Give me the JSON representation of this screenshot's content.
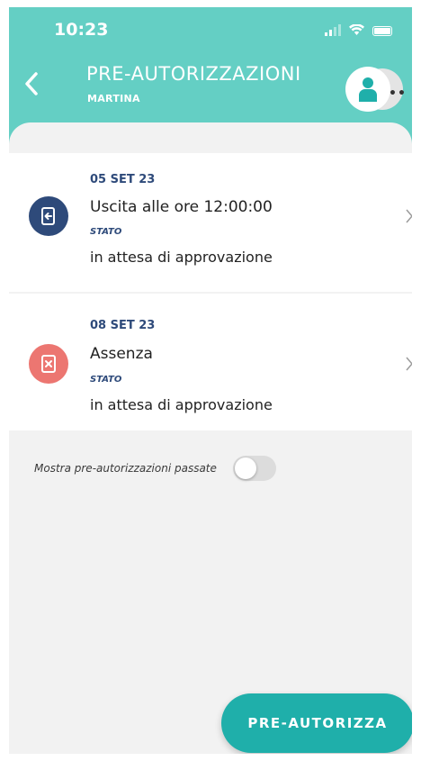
{
  "status_bar": {
    "time": "10:23"
  },
  "header": {
    "title": "PRE-AUTORIZZAZIONI",
    "subtitle": "MARTINA",
    "back_icon": "chevron-left-icon",
    "avatar_icon": "person-icon",
    "more_icon": "ellipsis-icon"
  },
  "items": [
    {
      "date": "05 SET 23",
      "title": "Uscita alle ore 12:00:00",
      "stato_label": "STATO",
      "status": "in attesa di approvazione",
      "icon": "exit-door-icon",
      "icon_color": "#2e4a7a"
    },
    {
      "date": "08 SET 23",
      "title": "Assenza",
      "stato_label": "STATO",
      "status": "in attesa di approvazione",
      "icon": "absence-x-icon",
      "icon_color": "#ec7671"
    }
  ],
  "toggle": {
    "label": "Mostra pre-autorizzazioni passate",
    "checked": false
  },
  "fab": {
    "label": "PRE-AUTORIZZA"
  },
  "colors": {
    "header": "#64cfc4",
    "accent": "#1fafaa",
    "background": "#f2f2f2"
  }
}
